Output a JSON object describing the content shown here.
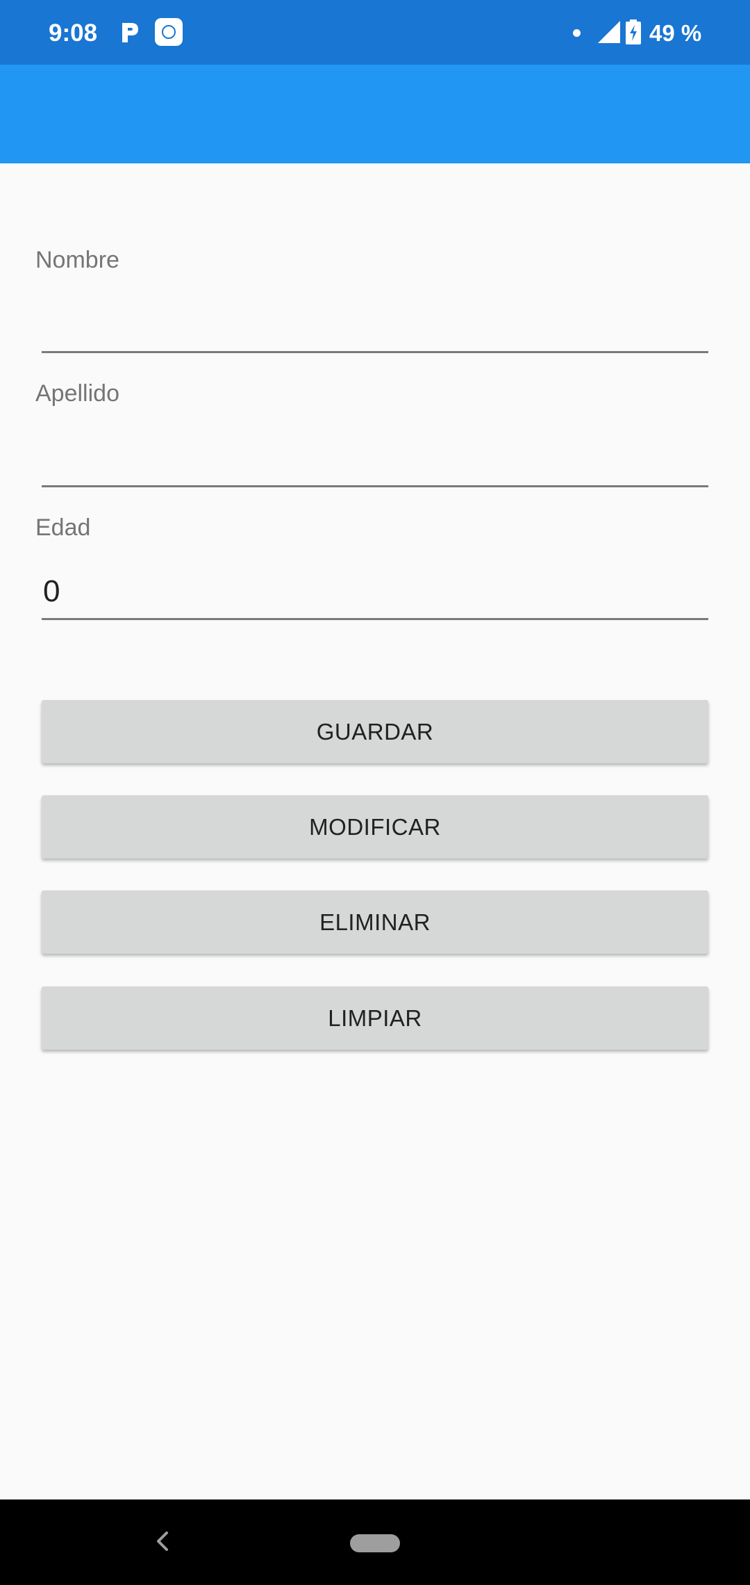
{
  "status_bar": {
    "time": "9:08",
    "battery_text": "49 %",
    "icons": [
      "parking-icon",
      "app-notification-icon",
      "notification-dot-icon",
      "cell-signal-icon",
      "battery-charging-icon"
    ]
  },
  "form": {
    "nombre": {
      "label": "Nombre",
      "value": ""
    },
    "apellido": {
      "label": "Apellido",
      "value": ""
    },
    "edad": {
      "label": "Edad",
      "value": "0"
    }
  },
  "buttons": {
    "guardar": "GUARDAR",
    "modificar": "MODIFICAR",
    "eliminar": "ELIMINAR",
    "limpiar": "LIMPIAR"
  },
  "colors": {
    "status_bar": "#1976d2",
    "app_bar": "#2196f3",
    "background": "#fafafa",
    "button": "#d6d7d7"
  }
}
